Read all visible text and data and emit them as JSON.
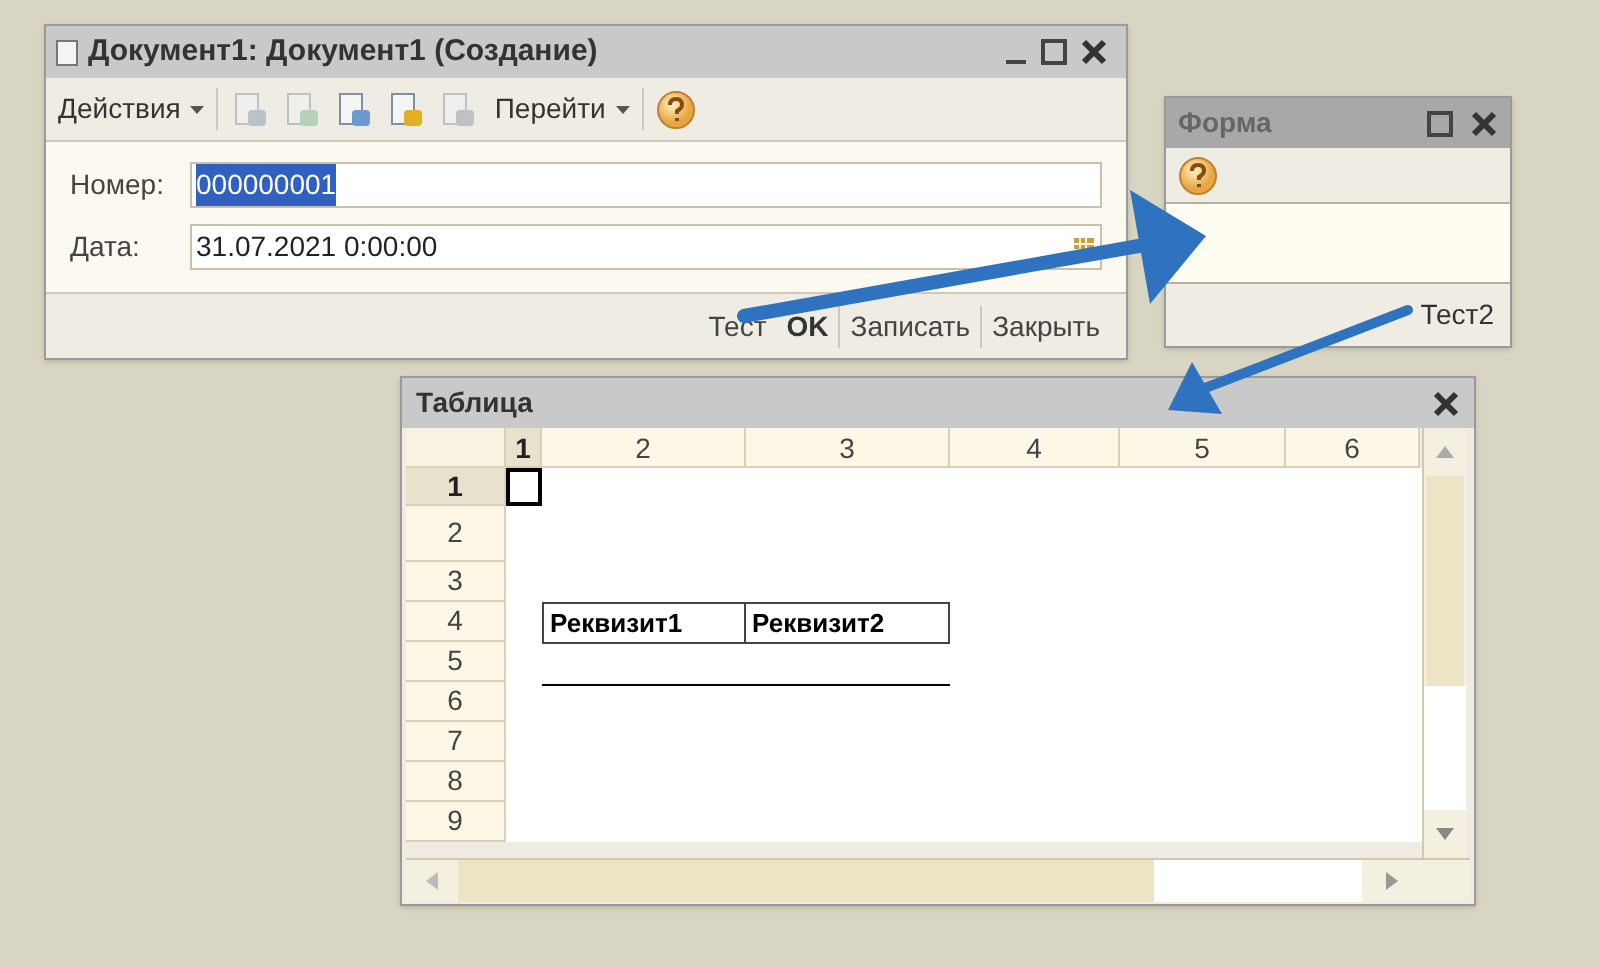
{
  "document_window": {
    "title": "Документ1: Документ1 (Создание)",
    "toolbar": [
      {
        "kind": "menu",
        "label": "Действия"
      },
      {
        "kind": "icon",
        "disabled": true
      },
      {
        "kind": "icon",
        "disabled": true
      },
      {
        "kind": "icon",
        "disabled": false
      },
      {
        "kind": "icon",
        "disabled": false
      },
      {
        "kind": "icon",
        "disabled": true
      },
      {
        "kind": "menu",
        "label": "Перейти"
      },
      {
        "kind": "help"
      }
    ],
    "fields": [
      {
        "label": "Номер:",
        "value": "000000001",
        "selected": true,
        "kind": "text"
      },
      {
        "label": "Дата:",
        "value": "31.07.2021  0:00:00",
        "selected": false,
        "kind": "date"
      }
    ],
    "buttons": [
      {
        "label": "Тест",
        "kind": "plain"
      },
      {
        "label": "OK",
        "kind": "default"
      },
      {
        "label": "Записать",
        "kind": "plain"
      },
      {
        "label": "Закрыть",
        "kind": "plain"
      }
    ]
  },
  "form_window": {
    "title": "Форма",
    "buttons": [
      "Тест2"
    ]
  },
  "table_window": {
    "title": "Таблица",
    "columns": [
      {
        "label": "1",
        "selected": true
      },
      {
        "label": "2",
        "selected": false
      },
      {
        "label": "3",
        "selected": false
      },
      {
        "label": "4",
        "selected": false
      },
      {
        "label": "5",
        "selected": false
      },
      {
        "label": "6",
        "selected": false
      }
    ],
    "rows": [
      {
        "label": "1",
        "selected": true
      },
      {
        "label": "2",
        "selected": false
      },
      {
        "label": "3",
        "selected": false
      },
      {
        "label": "4",
        "selected": false
      },
      {
        "label": "5",
        "selected": false
      },
      {
        "label": "6",
        "selected": false
      },
      {
        "label": "7",
        "selected": false
      },
      {
        "label": "8",
        "selected": false
      },
      {
        "label": "9",
        "selected": false
      }
    ],
    "cells": [
      "Реквизит1",
      "Реквизит2"
    ]
  }
}
